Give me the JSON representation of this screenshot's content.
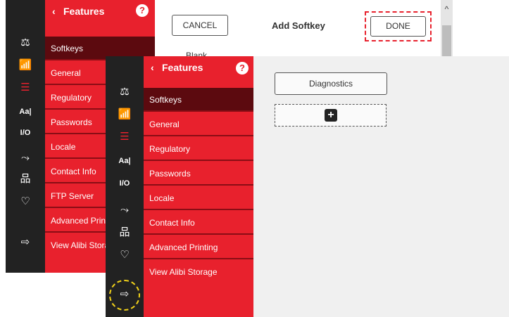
{
  "back": {
    "sidebar": {
      "header": {
        "back_icon": "‹",
        "title": "Features",
        "help_icon": "?"
      },
      "items": [
        "Softkeys",
        "General",
        "Regulatory",
        "Passwords",
        "Locale",
        "Contact Info",
        "FTP Server",
        "Advanced Printing",
        "View Alibi Storage"
      ],
      "selected_index": 0
    },
    "toolbar": {
      "cancel_label": "CANCEL",
      "title": "Add Softkey",
      "done_label": "DONE"
    },
    "list": {
      "first_item": "Blank"
    }
  },
  "front": {
    "sidebar": {
      "header": {
        "back_icon": "‹",
        "title": "Features",
        "help_icon": "?"
      },
      "items": [
        "Softkeys",
        "General",
        "Regulatory",
        "Passwords",
        "Locale",
        "Contact Info",
        "Advanced Printing",
        "View Alibi Storage"
      ],
      "selected_index": 0
    },
    "content": {
      "softkey_label": "Diagnostics",
      "add_icon": "+"
    }
  },
  "rail_icons": {
    "scale": "⚖",
    "network": "📶",
    "features": "☰",
    "language": "Aa|",
    "io": "I/O",
    "connectivity": "⤳",
    "hierarchy": "品",
    "health": "♡",
    "export": "⇨"
  },
  "colors": {
    "brand_red": "#e8212d",
    "selected_red": "#5c0a0f",
    "rail": "#222222",
    "highlight_yellow": "#f2d21a"
  }
}
